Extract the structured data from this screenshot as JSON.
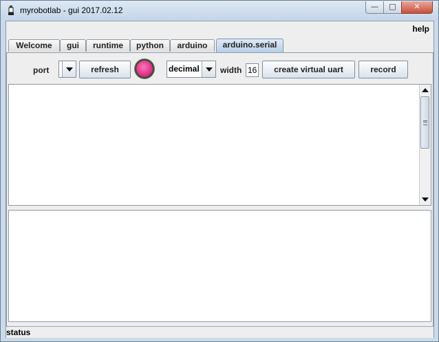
{
  "window": {
    "title": "myrobotlab - gui 2017.02.12",
    "controls": {
      "minimize": "—",
      "maximize": "□",
      "close": "✕"
    }
  },
  "menubar": {
    "help": "help"
  },
  "tabs": [
    {
      "label": "Welcome",
      "active": false
    },
    {
      "label": "gui",
      "active": false
    },
    {
      "label": "runtime",
      "active": false
    },
    {
      "label": "python",
      "active": false
    },
    {
      "label": "arduino",
      "active": false
    },
    {
      "label": "arduino.serial",
      "active": true
    }
  ],
  "toolbar": {
    "port_label": "port",
    "port_value": "",
    "refresh_label": "refresh",
    "connection_led_color": "#e6338c",
    "format_value": "decimal",
    "width_label": "width",
    "width_value": "16",
    "create_virtual_uart_label": "create virtual uart",
    "record_label": "record"
  },
  "rx_area": {
    "text": ""
  },
  "tx_area": {
    "text": ""
  },
  "statusbar": {
    "text": "status"
  }
}
